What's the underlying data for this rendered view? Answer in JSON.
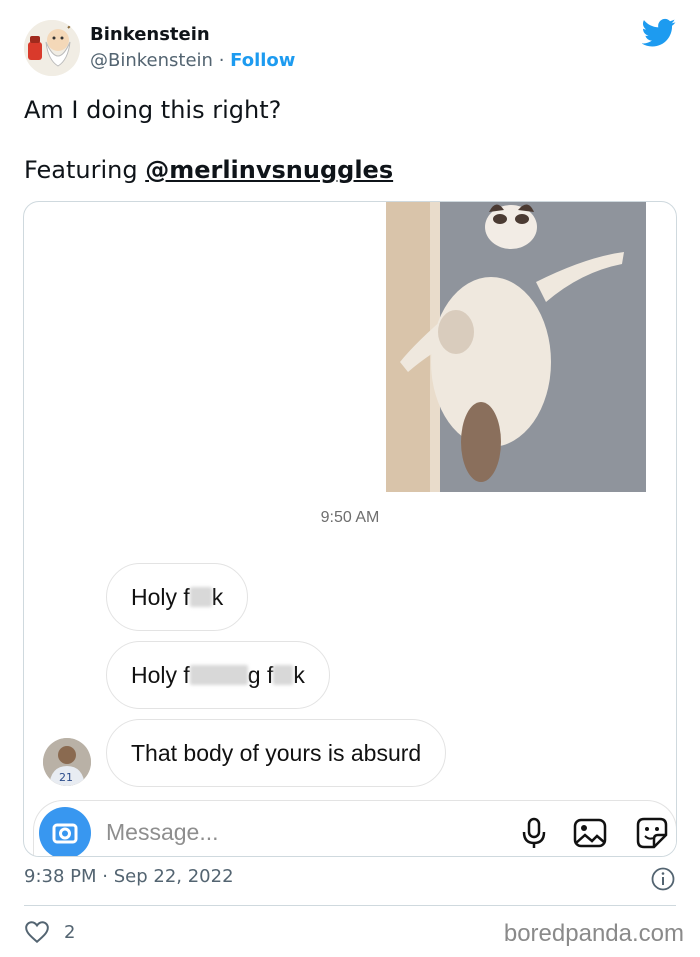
{
  "author": {
    "name": "Binkenstein",
    "handle": "@Binkenstein",
    "separator": "·",
    "follow_label": "Follow"
  },
  "tweet": {
    "line1": "Am I doing this right?",
    "line2_prefix": "Featuring ",
    "mention": "@merlinvsnuggles"
  },
  "screenshot": {
    "photo_icon": "cat-photo",
    "message_time": "9:50 AM",
    "messages": [
      {
        "parts": [
          "Holy f",
          "k"
        ],
        "censored": true
      },
      {
        "parts": [
          "Holy f",
          "g f",
          "k"
        ],
        "censored": true
      },
      {
        "parts": [
          "That body of yours is absurd"
        ],
        "censored": false
      }
    ],
    "composer_placeholder": "Message...",
    "camera_color": "#3897f0"
  },
  "meta": {
    "time": "9:38 PM",
    "separator": "·",
    "date": "Sep 22, 2022"
  },
  "likes": {
    "count": "2"
  },
  "watermark": "boredpanda.com",
  "colors": {
    "twitter_blue": "#1d9bf0",
    "text_secondary": "#536471",
    "border": "#cfd9de"
  }
}
